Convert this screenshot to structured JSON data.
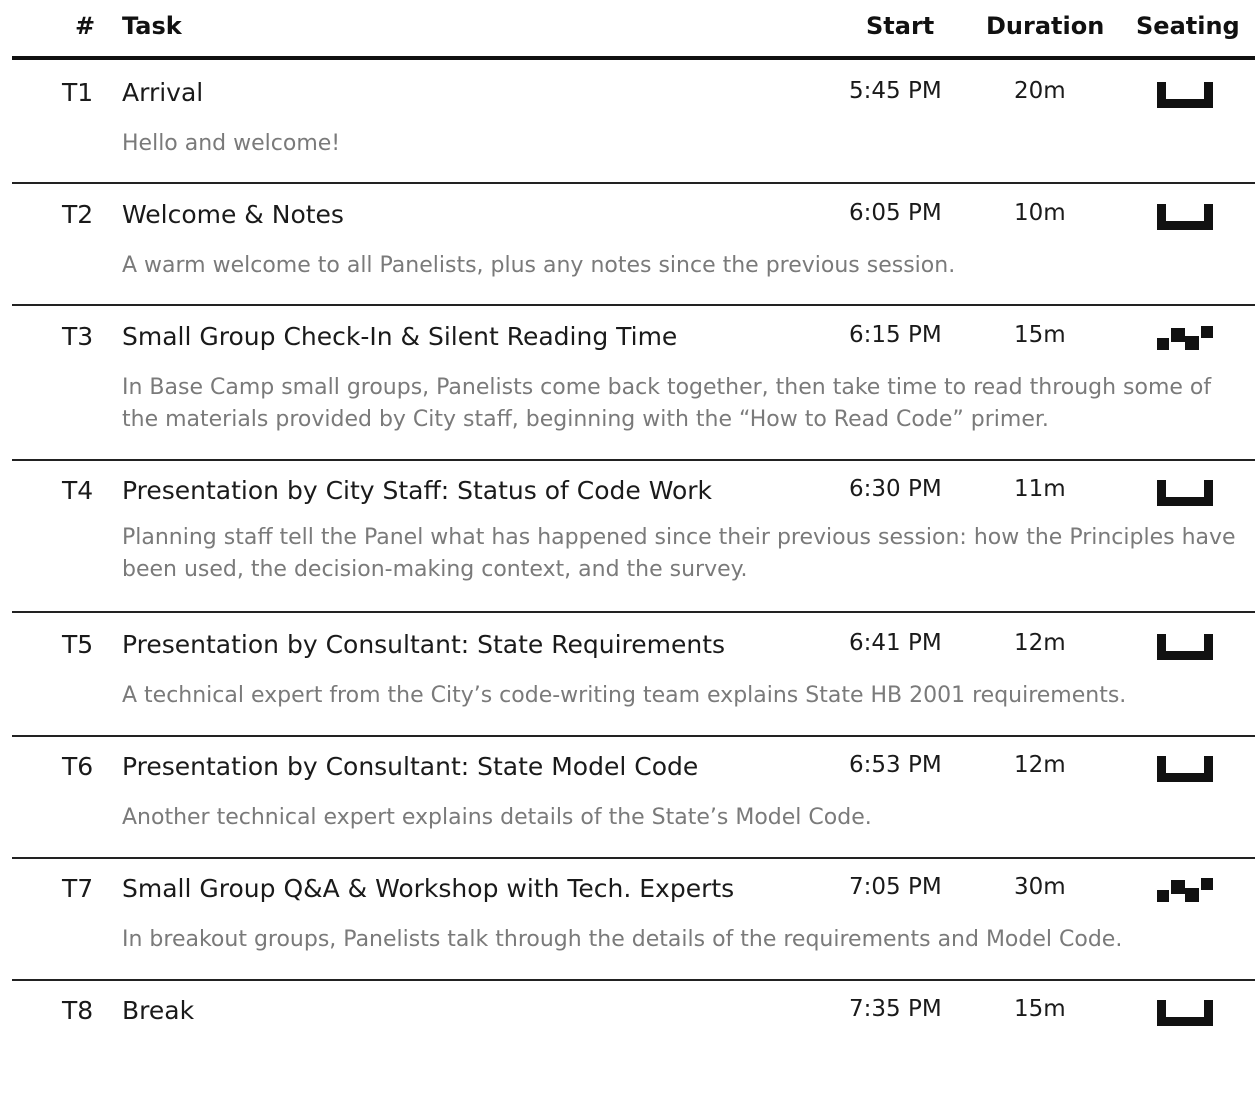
{
  "header": {
    "num": "#",
    "task": "Task",
    "start": "Start",
    "duration": "Duration",
    "seating": "Seating"
  },
  "rows": [
    {
      "id": "T1",
      "title": "Arrival",
      "start": "5:45 PM",
      "duration": "20m",
      "seating_icon": "plenary-seating-icon",
      "description": "Hello and welcome!"
    },
    {
      "id": "T2",
      "title": "Welcome & Notes",
      "start": "6:05 PM",
      "duration": "10m",
      "seating_icon": "plenary-seating-icon",
      "description": "A warm welcome to all Panelists, plus any notes since the previous session."
    },
    {
      "id": "T3",
      "title": "Small Group Check-In & Silent Reading Time",
      "start": "6:15 PM",
      "duration": "15m",
      "seating_icon": "small-group-seating-icon",
      "description": "In Base Camp small groups, Panelists come back together, then take time to read through some of the materials provided by City staff, beginning with the “How to Read Code” primer."
    },
    {
      "id": "T4",
      "title": "Presentation by City Staff: Status of Code Work",
      "start": "6:30 PM",
      "duration": "11m",
      "seating_icon": "plenary-seating-icon",
      "description": "Planning staff tell the Panel what has happened since their previous session: how the Principles have been used, the decision-making context, and the survey."
    },
    {
      "id": "T5",
      "title": "Presentation by Consultant: State Requirements",
      "start": "6:41 PM",
      "duration": "12m",
      "seating_icon": "plenary-seating-icon",
      "description": "A technical expert from the City’s code-writing team explains State HB 2001 requirements."
    },
    {
      "id": "T6",
      "title": "Presentation by Consultant: State Model Code",
      "start": "6:53 PM",
      "duration": "12m",
      "seating_icon": "plenary-seating-icon",
      "description": "Another technical expert explains details of the State’s Model Code."
    },
    {
      "id": "T7",
      "title": "Small Group Q&A & Workshop with Tech. Experts",
      "start": "7:05 PM",
      "duration": "30m",
      "seating_icon": "small-group-seating-icon",
      "description": "In breakout groups, Panelists talk through the details of the requirements and Model Code."
    },
    {
      "id": "T8",
      "title": "Break",
      "start": "7:35 PM",
      "duration": "15m",
      "seating_icon": "plenary-seating-icon",
      "description": ""
    }
  ]
}
